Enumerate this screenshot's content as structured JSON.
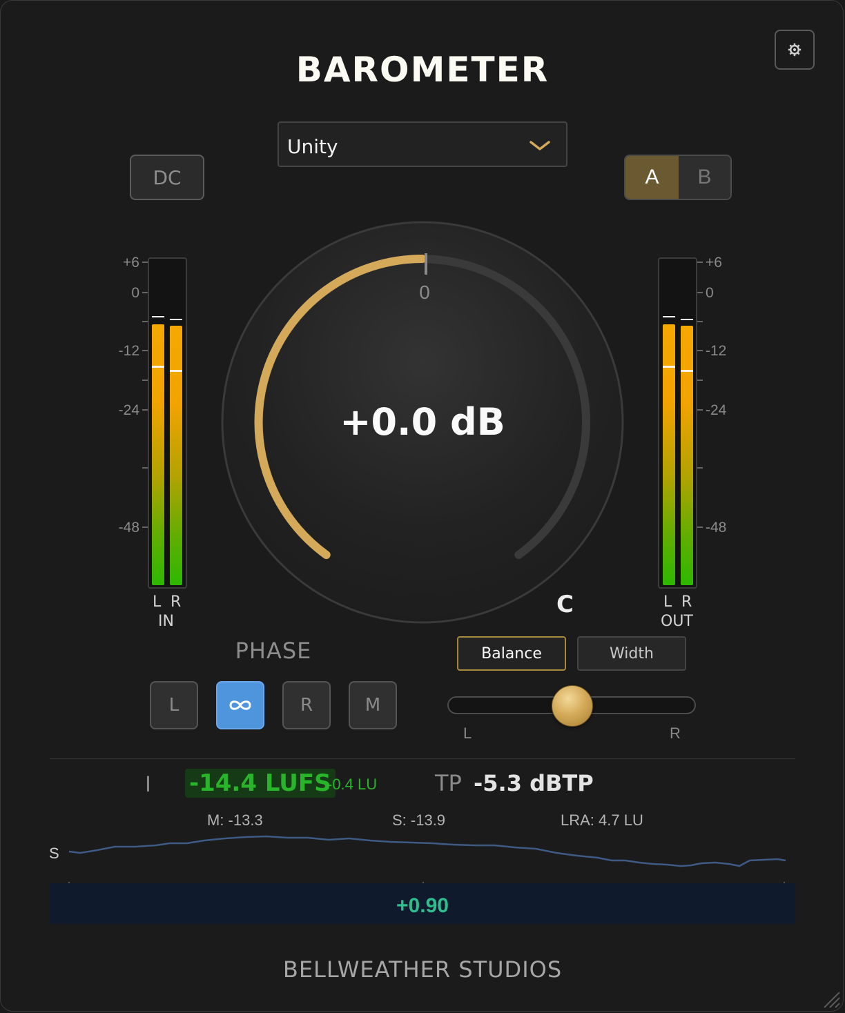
{
  "app": {
    "title": "BAROMETER",
    "brand": "BELLWEATHER STUDIOS"
  },
  "settings": {
    "icon": "gear-icon"
  },
  "preset": {
    "selected": "Unity",
    "icon": "chevron-down-icon"
  },
  "dc_button": {
    "label": "DC"
  },
  "ab": {
    "a_label": "A",
    "b_label": "B",
    "active": "A"
  },
  "meter_scale": {
    "ticks": [
      "+6",
      "0",
      "-12",
      "-24",
      "-48"
    ]
  },
  "input_meter": {
    "left_label": "L",
    "right_label": "R",
    "caption": "IN"
  },
  "output_meter": {
    "left_label": "L",
    "right_label": "R",
    "caption": "OUT"
  },
  "knob": {
    "value_text": "+0.0 dB",
    "zero_label": "0"
  },
  "pan": {
    "position_label": "C",
    "modes": [
      "Balance",
      "Width"
    ],
    "active_mode": "Balance",
    "left_label": "L",
    "right_label": "R",
    "position": 0.5
  },
  "phase": {
    "title": "PHASE",
    "buttons": [
      "L",
      "∞",
      "R",
      "M"
    ],
    "active": "∞"
  },
  "loudness": {
    "integrated_label": "I",
    "integrated": "-14.4 LUFS",
    "delta": "-0.4 LU",
    "tp_label": "TP",
    "true_peak": "-5.3 dBTP",
    "momentary": "M: -13.3",
    "short_term": "S: -13.9",
    "lra": "LRA: 4.7 LU",
    "history_label": "S"
  },
  "correlation": {
    "value": "+0.90"
  },
  "colors": {
    "accent": "#d4aa5a",
    "active_blue": "#4f95de",
    "meter_orange": "#f5a800",
    "meter_green": "#2eb800",
    "lufs_green": "#29b529",
    "correlation_green": "#2fbe8e"
  }
}
